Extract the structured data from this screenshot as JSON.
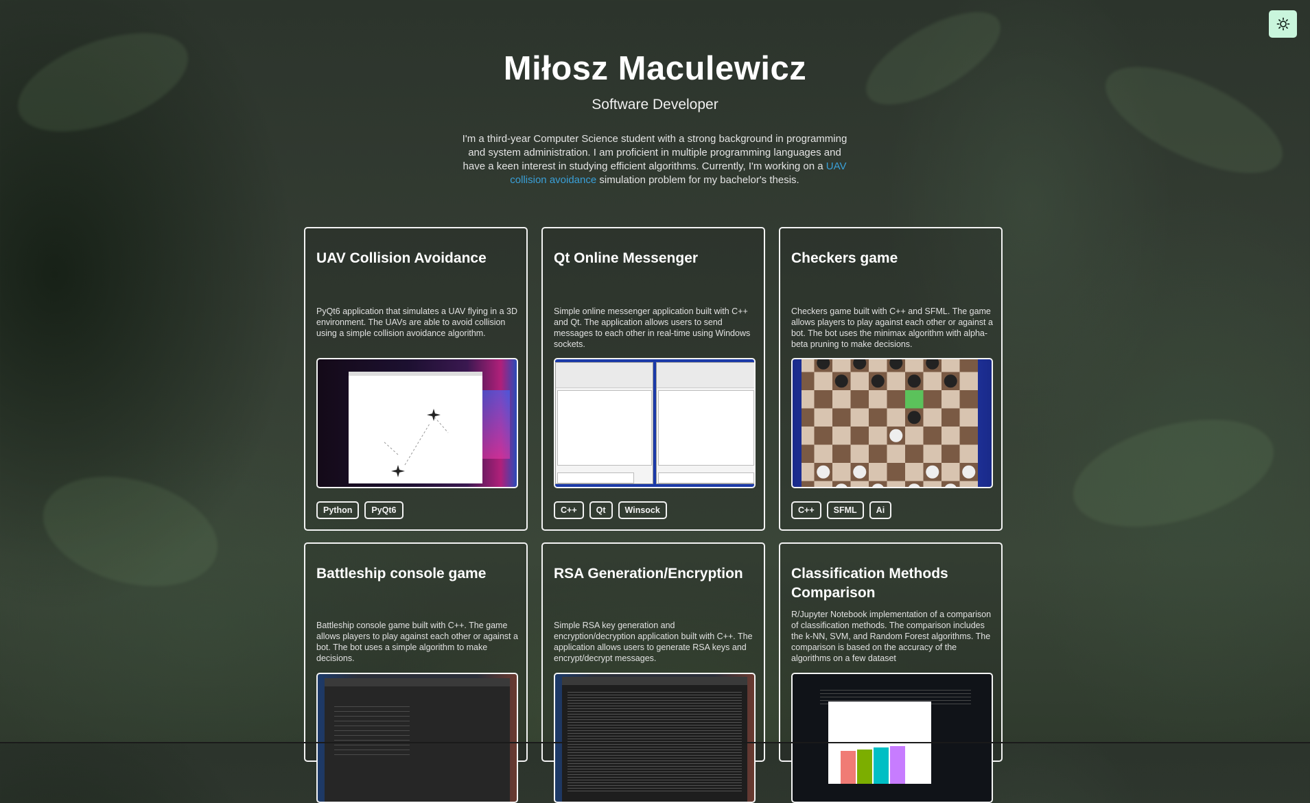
{
  "profile": {
    "name": "Miłosz Maculewicz",
    "role": "Software Developer",
    "intro_before": "I'm a third-year Computer Science student with a strong background in programming and system administration. I am proficient in multiple programming languages and have a keen interest in studying efficient algorithms. Currently, I'm working on a ",
    "intro_link": "UAV collision avoidance",
    "intro_after": " simulation problem for my bachelor's thesis."
  },
  "theme_toggle": {
    "icon": "sun-icon"
  },
  "colors": {
    "link": "#3aa0d8",
    "toggle_bg": "#c9f5dc"
  },
  "projects": [
    {
      "title": "UAV Collision Avoidance",
      "description": "PyQt6 application that simulates a UAV flying in a 3D environment. The UAVs are able to avoid collision using a simple collision avoidance algorithm.",
      "image": "uav-screenshot",
      "tags": [
        "Python",
        "PyQt6"
      ]
    },
    {
      "title": "Qt Online Messenger",
      "description": "Simple online messenger application built with C++ and Qt. The application allows users to send messages to each other in real-time using Windows sockets.",
      "image": "messenger-screenshot",
      "tags": [
        "C++",
        "Qt",
        "Winsock"
      ]
    },
    {
      "title": "Checkers game",
      "description": "Checkers game built with C++ and SFML. The game allows players to play against each other or against a bot. The bot uses the minimax algorithm with alpha-beta pruning to make decisions.",
      "image": "checkers-screenshot",
      "tags": [
        "C++",
        "SFML",
        "Ai"
      ]
    },
    {
      "title": "Battleship console game",
      "description": "Battleship console game built with C++. The game allows players to play against each other or against a bot. The bot uses a simple algorithm to make decisions.",
      "image": "battleship-screenshot",
      "tags": []
    },
    {
      "title": "RSA Generation/Encryption",
      "description": "Simple RSA key generation and encryption/decryption application built with C++. The application allows users to generate RSA keys and encrypt/decrypt messages.",
      "image": "rsa-screenshot",
      "tags": []
    },
    {
      "title": "Classification Methods Comparison",
      "description": "R/Jupyter Notebook implementation of a comparison of classification methods. The comparison includes the k-NN, SVM, and Random Forest algorithms. The comparison is based on the accuracy of the algorithms on a few dataset",
      "image": "classification-screenshot",
      "tags": []
    }
  ]
}
